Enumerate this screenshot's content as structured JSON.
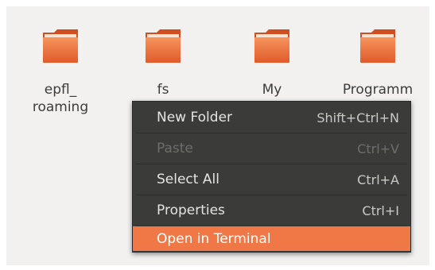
{
  "folders": [
    {
      "label": "epfl_\nroaming"
    },
    {
      "label": "fs"
    },
    {
      "label": "My\nDocuments"
    },
    {
      "label": "Programm\nation"
    }
  ],
  "context_menu": {
    "items": [
      {
        "label": "New Folder",
        "shortcut": "Shift+Ctrl+N",
        "enabled": true
      },
      {
        "label": "Paste",
        "shortcut": "Ctrl+V",
        "enabled": false
      },
      {
        "label": "Select All",
        "shortcut": "Ctrl+A",
        "enabled": true
      },
      {
        "label": "Properties",
        "shortcut": "Ctrl+I",
        "enabled": true
      },
      {
        "label": "Open in Terminal",
        "shortcut": "",
        "enabled": true,
        "highlighted": true
      }
    ]
  },
  "colors": {
    "folder_orange": "#f07746",
    "menu_bg": "#3b3b39",
    "highlight": "#f07746"
  }
}
